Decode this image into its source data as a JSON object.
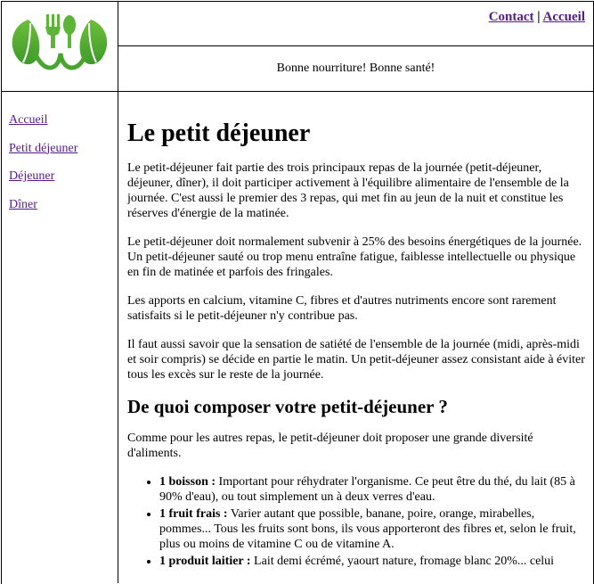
{
  "header": {
    "logo_icon": "fork-leaf-logo-icon",
    "links": {
      "contact": "Contact",
      "separator": "|",
      "home": "Accueil"
    },
    "tagline": "Bonne nourriture! Bonne santé!"
  },
  "sidebar": {
    "items": [
      {
        "label": "Accueil"
      },
      {
        "label": "Petit déjeuner"
      },
      {
        "label": "Déjeuner"
      },
      {
        "label": "Dîner"
      }
    ]
  },
  "main": {
    "title": "Le petit déjeuner",
    "paragraphs": [
      "Le petit-déjeuner fait partie des trois principaux repas de la journée (petit-déjeuner, déjeuner, dîner), il doit participer activement à l'équilibre alimentaire de l'ensemble de la journée. C'est aussi le premier des 3 repas, qui met fin au jeun de la nuit et constitue les réserves d'énergie de la matinée.",
      "Le petit-déjeuner doit normalement subvenir à 25% des besoins énergétiques de la journée. Un petit-déjeuner sauté ou trop menu entraîne fatigue, faiblesse intellectuelle ou physique en fin de matinée et parfois des fringales.",
      "Les apports en calcium, vitamine C, fibres et d'autres nutriments encore sont rarement satisfaits si le petit-déjeuner n'y contribue pas.",
      "Il faut aussi savoir que la sensation de satiété de l'ensemble de la journée (midi, après-midi et soir compris) se décide en partie le matin. Un petit-déjeuner assez consistant aide à éviter tous les excès sur le reste de la journée."
    ],
    "subtitle": "De quoi composer votre petit-déjeuner ?",
    "intro": "Comme pour les autres repas, le petit-déjeuner doit proposer une grande diversité d'aliments.",
    "list": [
      {
        "title": "1 boisson :",
        "text": " Important pour réhydrater l'organisme. Ce peut être du thé, du lait (85 à 90% d'eau), ou tout simplement un à deux verres d'eau."
      },
      {
        "title": "1 fruit frais :",
        "text": " Varier autant que possible, banane, poire, orange, mirabelles, pommes... Tous les fruits sont bons, ils vous apporteront des fibres et, selon le fruit, plus ou moins de vitamine C ou de vitamine A."
      },
      {
        "title": "1 produit laitier :",
        "text": " Lait demi écrémé, yaourt nature, fromage blanc 20%... celui"
      }
    ]
  },
  "colors": {
    "link": "#551a8b",
    "logo_green": "#7ac143",
    "border": "#000000"
  }
}
